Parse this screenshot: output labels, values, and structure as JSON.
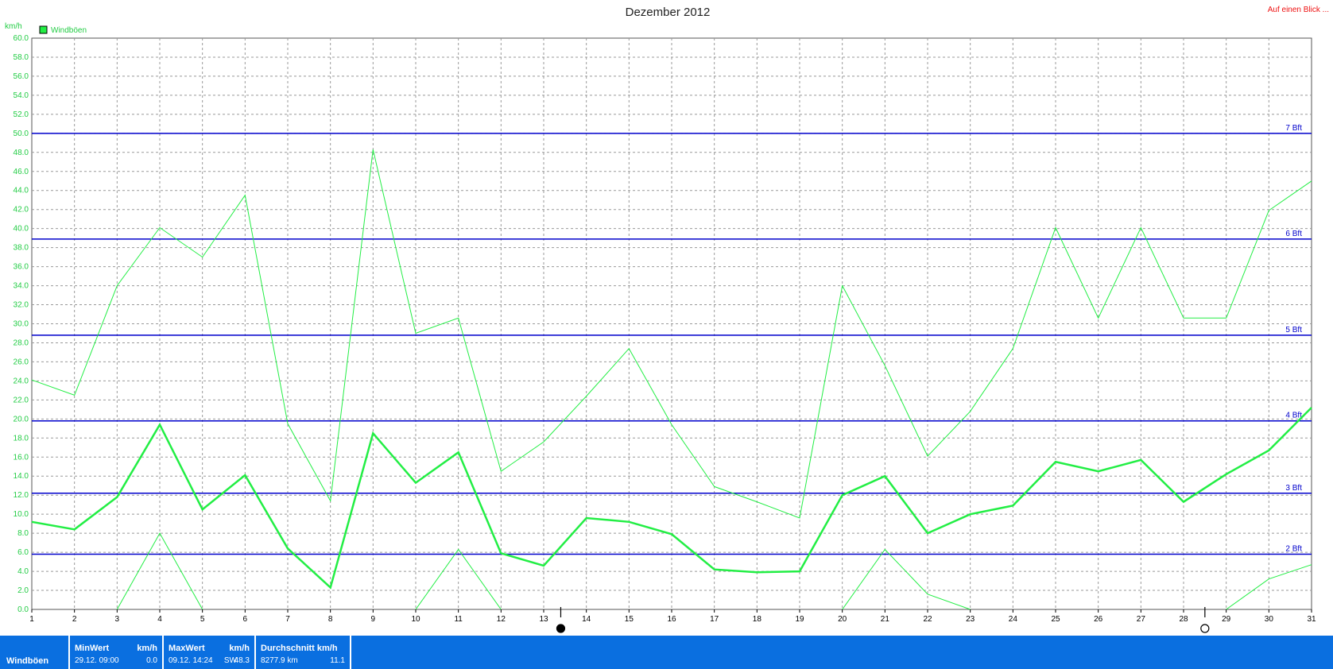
{
  "header": {
    "title": "Dezember 2012",
    "link_text": "Auf einen Blick ..."
  },
  "colors": {
    "series": "#22ee44",
    "bft_lines": "#0000cc",
    "stats_bar": "#0a6fe0",
    "link": "#ee1111"
  },
  "chart_data": {
    "type": "line",
    "title": "Dezember 2012",
    "ylabel": "km/h",
    "ylim": [
      0,
      60
    ],
    "y_tick_step": 2,
    "x": [
      1,
      2,
      3,
      4,
      5,
      6,
      7,
      8,
      9,
      10,
      11,
      12,
      13,
      14,
      15,
      16,
      17,
      18,
      19,
      20,
      21,
      22,
      23,
      24,
      25,
      26,
      27,
      28,
      29,
      30,
      31
    ],
    "legend": [
      "Windböen"
    ],
    "legend_placement": "top-left",
    "grid": true,
    "series": [
      {
        "name": "Windböen",
        "role": "mean",
        "values": [
          9.2,
          8.4,
          11.8,
          19.4,
          10.5,
          14.1,
          6.4,
          2.3,
          18.5,
          13.3,
          16.5,
          5.9,
          4.6,
          9.6,
          9.2,
          7.9,
          4.2,
          3.9,
          4.0,
          12.0,
          14.0,
          8.0,
          10.0,
          10.9,
          15.5,
          14.5,
          15.7,
          11.3,
          14.2,
          16.7,
          21.2
        ]
      },
      {
        "name": "",
        "role": "max",
        "values": [
          24.1,
          22.5,
          34.0,
          40.1,
          37.0,
          43.5,
          19.5,
          11.4,
          48.3,
          29.0,
          30.6,
          14.5,
          17.6,
          22.4,
          27.4,
          19.4,
          12.9,
          11.3,
          9.6,
          34.0,
          25.6,
          16.1,
          20.8,
          27.4,
          40.1,
          30.6,
          40.1,
          30.6,
          30.6,
          41.9,
          45.0
        ]
      },
      {
        "name": "",
        "role": "min",
        "values": [
          null,
          null,
          0.0,
          8.0,
          0.0,
          null,
          null,
          null,
          null,
          0.0,
          6.3,
          0.0,
          null,
          null,
          null,
          null,
          null,
          null,
          null,
          0.0,
          6.3,
          1.6,
          0.0,
          null,
          null,
          null,
          null,
          null,
          0.0,
          3.2,
          4.7
        ]
      }
    ],
    "annotations": [
      {
        "label": "2 Bft",
        "value": 5.8
      },
      {
        "label": "3 Bft",
        "value": 12.2
      },
      {
        "label": "4 Bft",
        "value": 19.8
      },
      {
        "label": "5 Bft",
        "value": 28.8
      },
      {
        "label": "6 Bft",
        "value": 38.9
      },
      {
        "label": "7 Bft",
        "value": 50.0
      }
    ],
    "moon_phases": [
      {
        "day": 13.4,
        "phase": "new-moon"
      },
      {
        "day": 28.5,
        "phase": "full-moon"
      }
    ]
  },
  "stats": {
    "row_label": "Windböen",
    "min": {
      "header": "MinWert",
      "unit": "km/h",
      "date": "29.12.  09:00",
      "value": "0.0"
    },
    "max": {
      "header": "MaxWert",
      "unit": "km/h",
      "date": "09.12.  14:24",
      "direction": "SW",
      "value": "48.3"
    },
    "avg": {
      "header": "Durchschnitt km/h",
      "distance": "8277.9 km",
      "value": "11.1"
    }
  }
}
